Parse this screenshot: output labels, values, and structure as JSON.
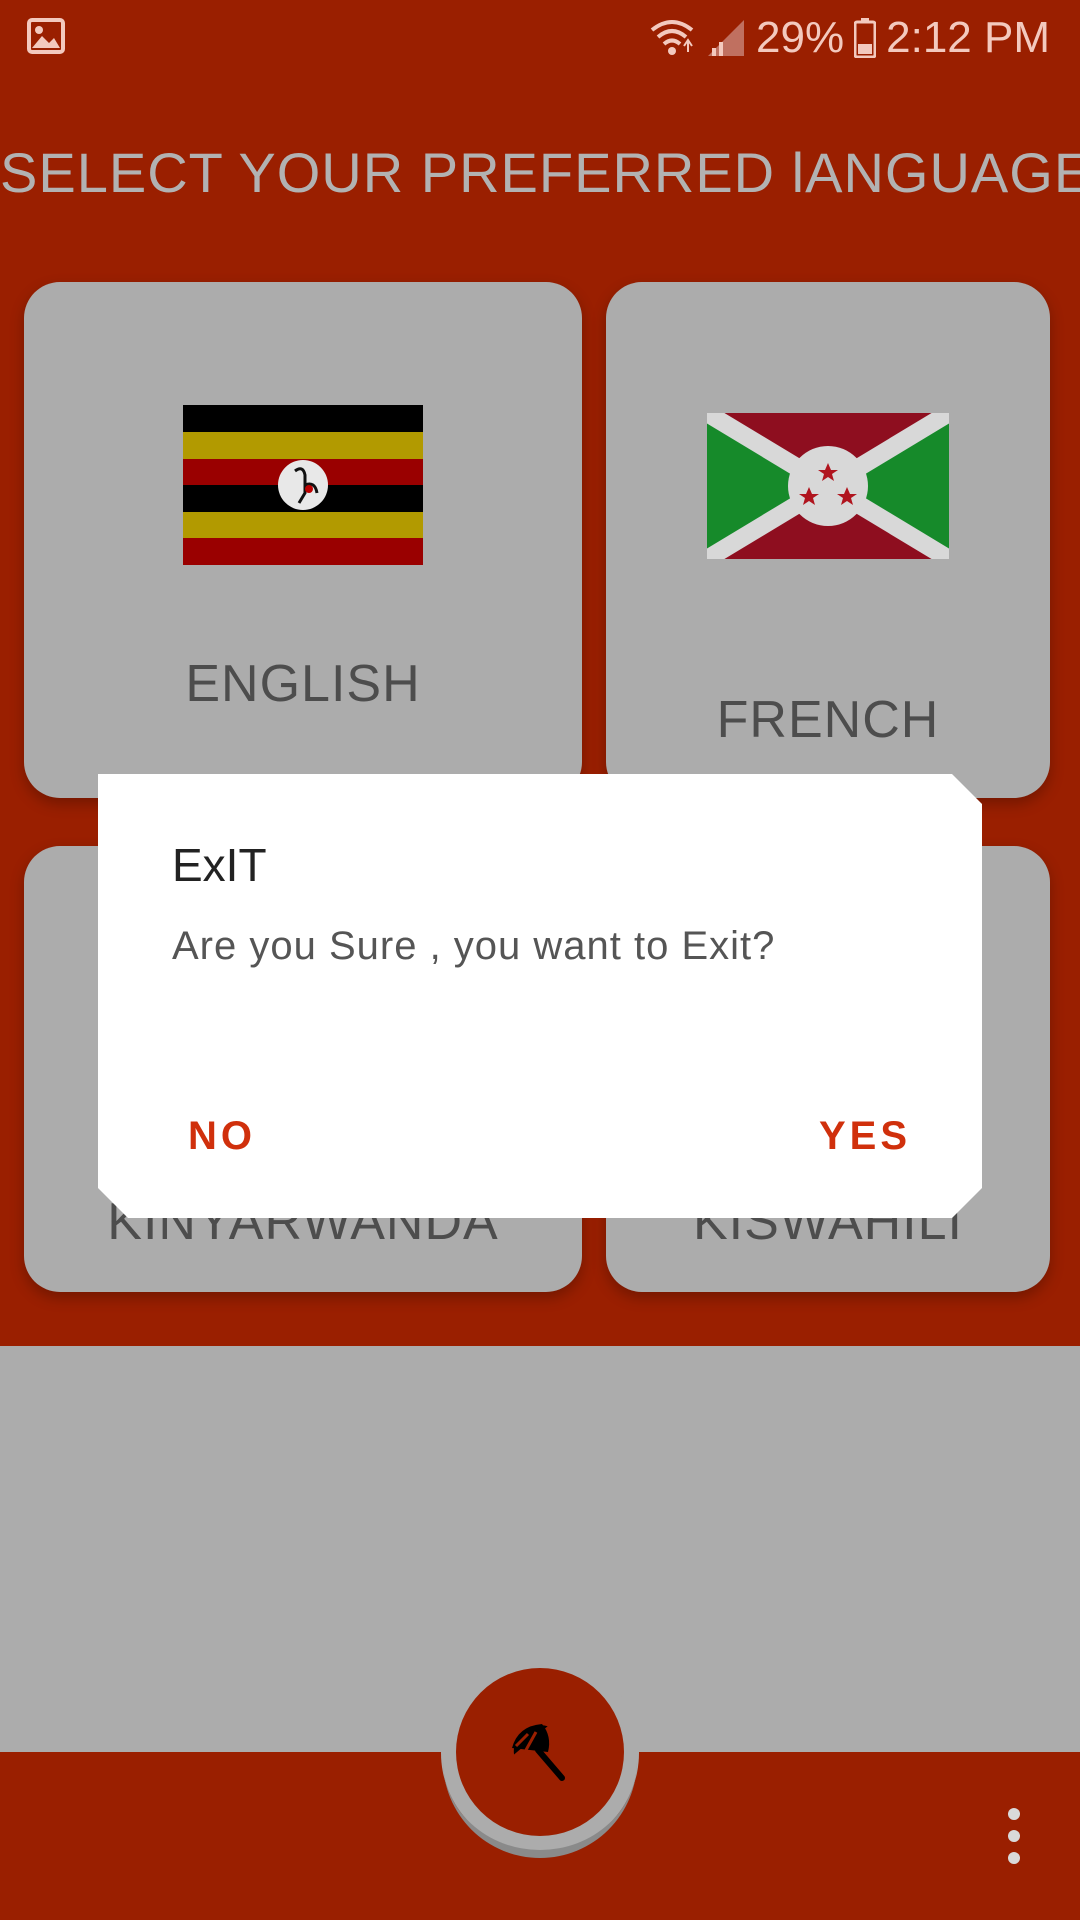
{
  "status_bar": {
    "battery_percent": "29%",
    "time": "2:12 PM",
    "icons": [
      "image-icon",
      "wifi-icon",
      "signal-icon",
      "battery-icon"
    ]
  },
  "page": {
    "title": "SELECT YOUR PREFERRED lANGUAGE"
  },
  "languages": [
    {
      "label": "ENGLISH",
      "flag": "uganda-flag"
    },
    {
      "label": "FRENCH",
      "flag": "burundi-flag"
    },
    {
      "label": "KINYARWANDA",
      "flag": ""
    },
    {
      "label": "KISWAHILI",
      "flag": ""
    }
  ],
  "dialog": {
    "title": "ExIT",
    "message": "Are you Sure , you want to Exit?",
    "negative": "NO",
    "positive": "YES"
  },
  "bottom_bar": {
    "fab_icon": "umbrella-icon",
    "menu_icon": "overflow-menu-icon"
  },
  "colors": {
    "primary": "#9a1f00",
    "accent": "#d0300c",
    "scrim_gray": "#acacac"
  }
}
